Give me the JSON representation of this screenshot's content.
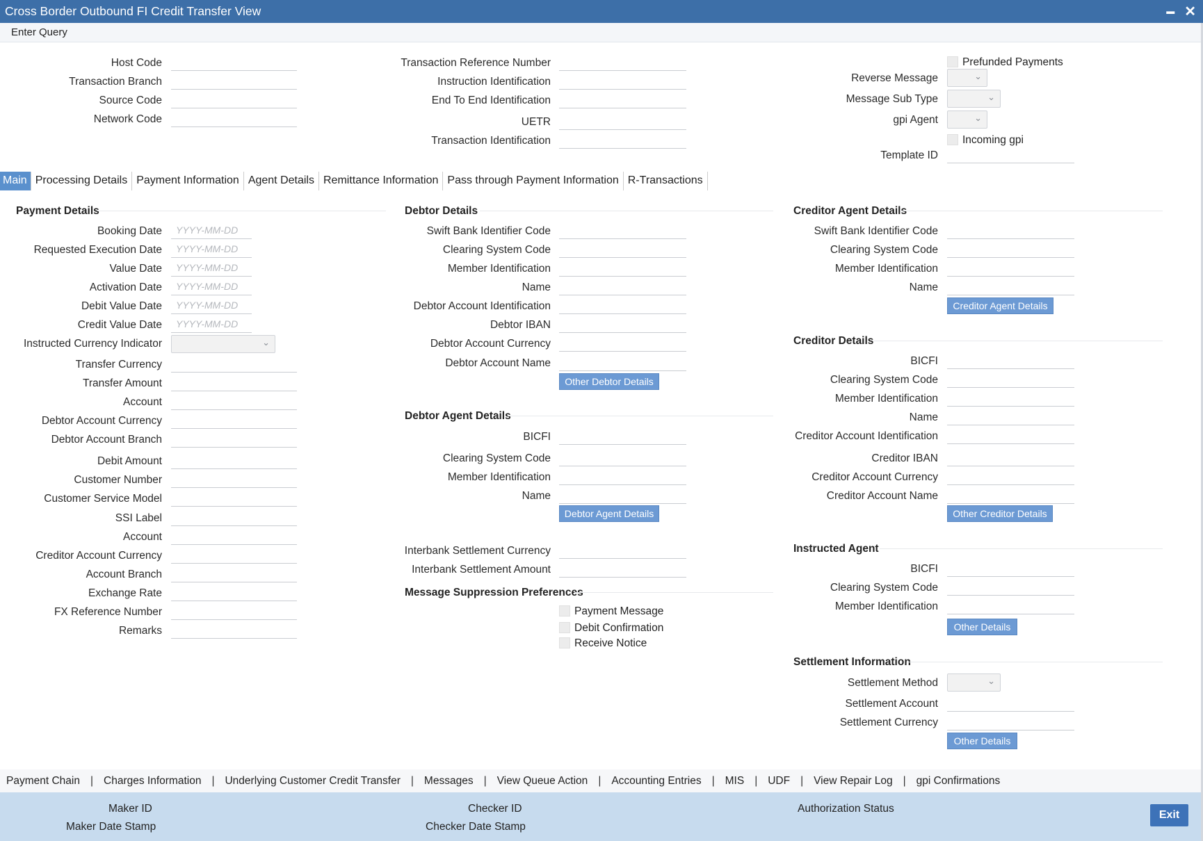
{
  "window": {
    "title": "Cross Border Outbound FI Credit Transfer View",
    "minimize": "▬",
    "close": "✕"
  },
  "toolbar": {
    "enter_query": "Enter Query"
  },
  "header": {
    "host_code": "Host Code",
    "transaction_branch": "Transaction Branch",
    "source_code": "Source Code",
    "network_code": "Network Code",
    "transaction_reference_number": "Transaction Reference Number",
    "instruction_identification": "Instruction Identification",
    "end_to_end_identification": "End To End Identification",
    "uetr": "UETR",
    "transaction_identification": "Transaction Identification",
    "prefunded_payments": "Prefunded Payments",
    "reverse_message": "Reverse Message",
    "message_sub_type": "Message Sub Type",
    "gpi_agent": "gpi Agent",
    "incoming_gpi": "Incoming gpi",
    "template_id": "Template ID"
  },
  "tabs": [
    "Main",
    "Processing Details",
    "Payment Information",
    "Agent Details",
    "Remittance Information",
    "Pass through Payment Information",
    "R-Transactions"
  ],
  "date_placeholder": "YYYY-MM-DD",
  "payment_details": {
    "title": "Payment Details",
    "booking_date": "Booking Date",
    "requested_execution_date": "Requested Execution Date",
    "value_date": "Value Date",
    "activation_date": "Activation Date",
    "debit_value_date": "Debit Value Date",
    "credit_value_date": "Credit Value Date",
    "instructed_currency_indicator": "Instructed Currency Indicator",
    "transfer_currency": "Transfer Currency",
    "transfer_amount": "Transfer Amount",
    "account": "Account",
    "debtor_account_currency": "Debtor Account Currency",
    "debtor_account_branch": "Debtor Account Branch",
    "debit_amount": "Debit Amount",
    "customer_number": "Customer Number",
    "customer_service_model": "Customer Service Model",
    "ssi_label": "SSI Label",
    "account2": "Account",
    "creditor_account_currency": "Creditor Account Currency",
    "account_branch": "Account Branch",
    "exchange_rate": "Exchange Rate",
    "fx_reference_number": "FX Reference Number",
    "remarks": "Remarks"
  },
  "debtor_details": {
    "title": "Debtor Details",
    "swift_bic": "Swift Bank Identifier Code",
    "clearing_system_code": "Clearing System Code",
    "member_identification": "Member Identification",
    "name": "Name",
    "debtor_account_identification": "Debtor Account Identification",
    "debtor_iban": "Debtor IBAN",
    "debtor_account_currency": "Debtor Account Currency",
    "debtor_account_name": "Debtor Account Name",
    "other_button": "Other Debtor Details"
  },
  "debtor_agent_details": {
    "title": "Debtor Agent Details",
    "bicfi": "BICFI",
    "clearing_system_code": "Clearing System Code",
    "member_identification": "Member Identification",
    "name": "Name",
    "button": "Debtor Agent Details"
  },
  "interbank": {
    "settlement_currency": "Interbank Settlement Currency",
    "settlement_amount": "Interbank Settlement Amount"
  },
  "suppression": {
    "title": "Message Suppression Preferences",
    "payment_message": "Payment Message",
    "debit_confirmation": "Debit Confirmation",
    "receive_notice": "Receive Notice"
  },
  "creditor_agent_details": {
    "title": "Creditor Agent Details",
    "swift_bic": "Swift Bank Identifier Code",
    "clearing_system_code": "Clearing System Code",
    "member_identification": "Member Identification",
    "name": "Name",
    "button": "Creditor Agent Details"
  },
  "creditor_details": {
    "title": "Creditor Details",
    "bicfi": "BICFI",
    "clearing_system_code": "Clearing System Code",
    "member_identification": "Member Identification",
    "name": "Name",
    "creditor_account_identification": "Creditor Account Identification",
    "creditor_iban": "Creditor IBAN",
    "creditor_account_currency": "Creditor Account Currency",
    "creditor_account_name": "Creditor Account Name",
    "button": "Other Creditor Details"
  },
  "instructed_agent": {
    "title": "Instructed Agent",
    "bicfi": "BICFI",
    "clearing_system_code": "Clearing System Code",
    "member_identification": "Member Identification",
    "button": "Other Details"
  },
  "settlement_information": {
    "title": "Settlement Information",
    "settlement_method": "Settlement Method",
    "settlement_account": "Settlement Account",
    "settlement_currency": "Settlement Currency",
    "button": "Other Details"
  },
  "bottom_links": [
    "Payment Chain",
    "Charges Information",
    "Underlying Customer Credit Transfer",
    "Messages",
    "View Queue Action",
    "Accounting Entries",
    "MIS",
    "UDF",
    "View Repair Log",
    "gpi Confirmations"
  ],
  "footer": {
    "maker_id": "Maker ID",
    "maker_date_stamp": "Maker Date Stamp",
    "checker_id": "Checker ID",
    "checker_date_stamp": "Checker Date Stamp",
    "authorization_status": "Authorization Status",
    "exit": "Exit"
  }
}
